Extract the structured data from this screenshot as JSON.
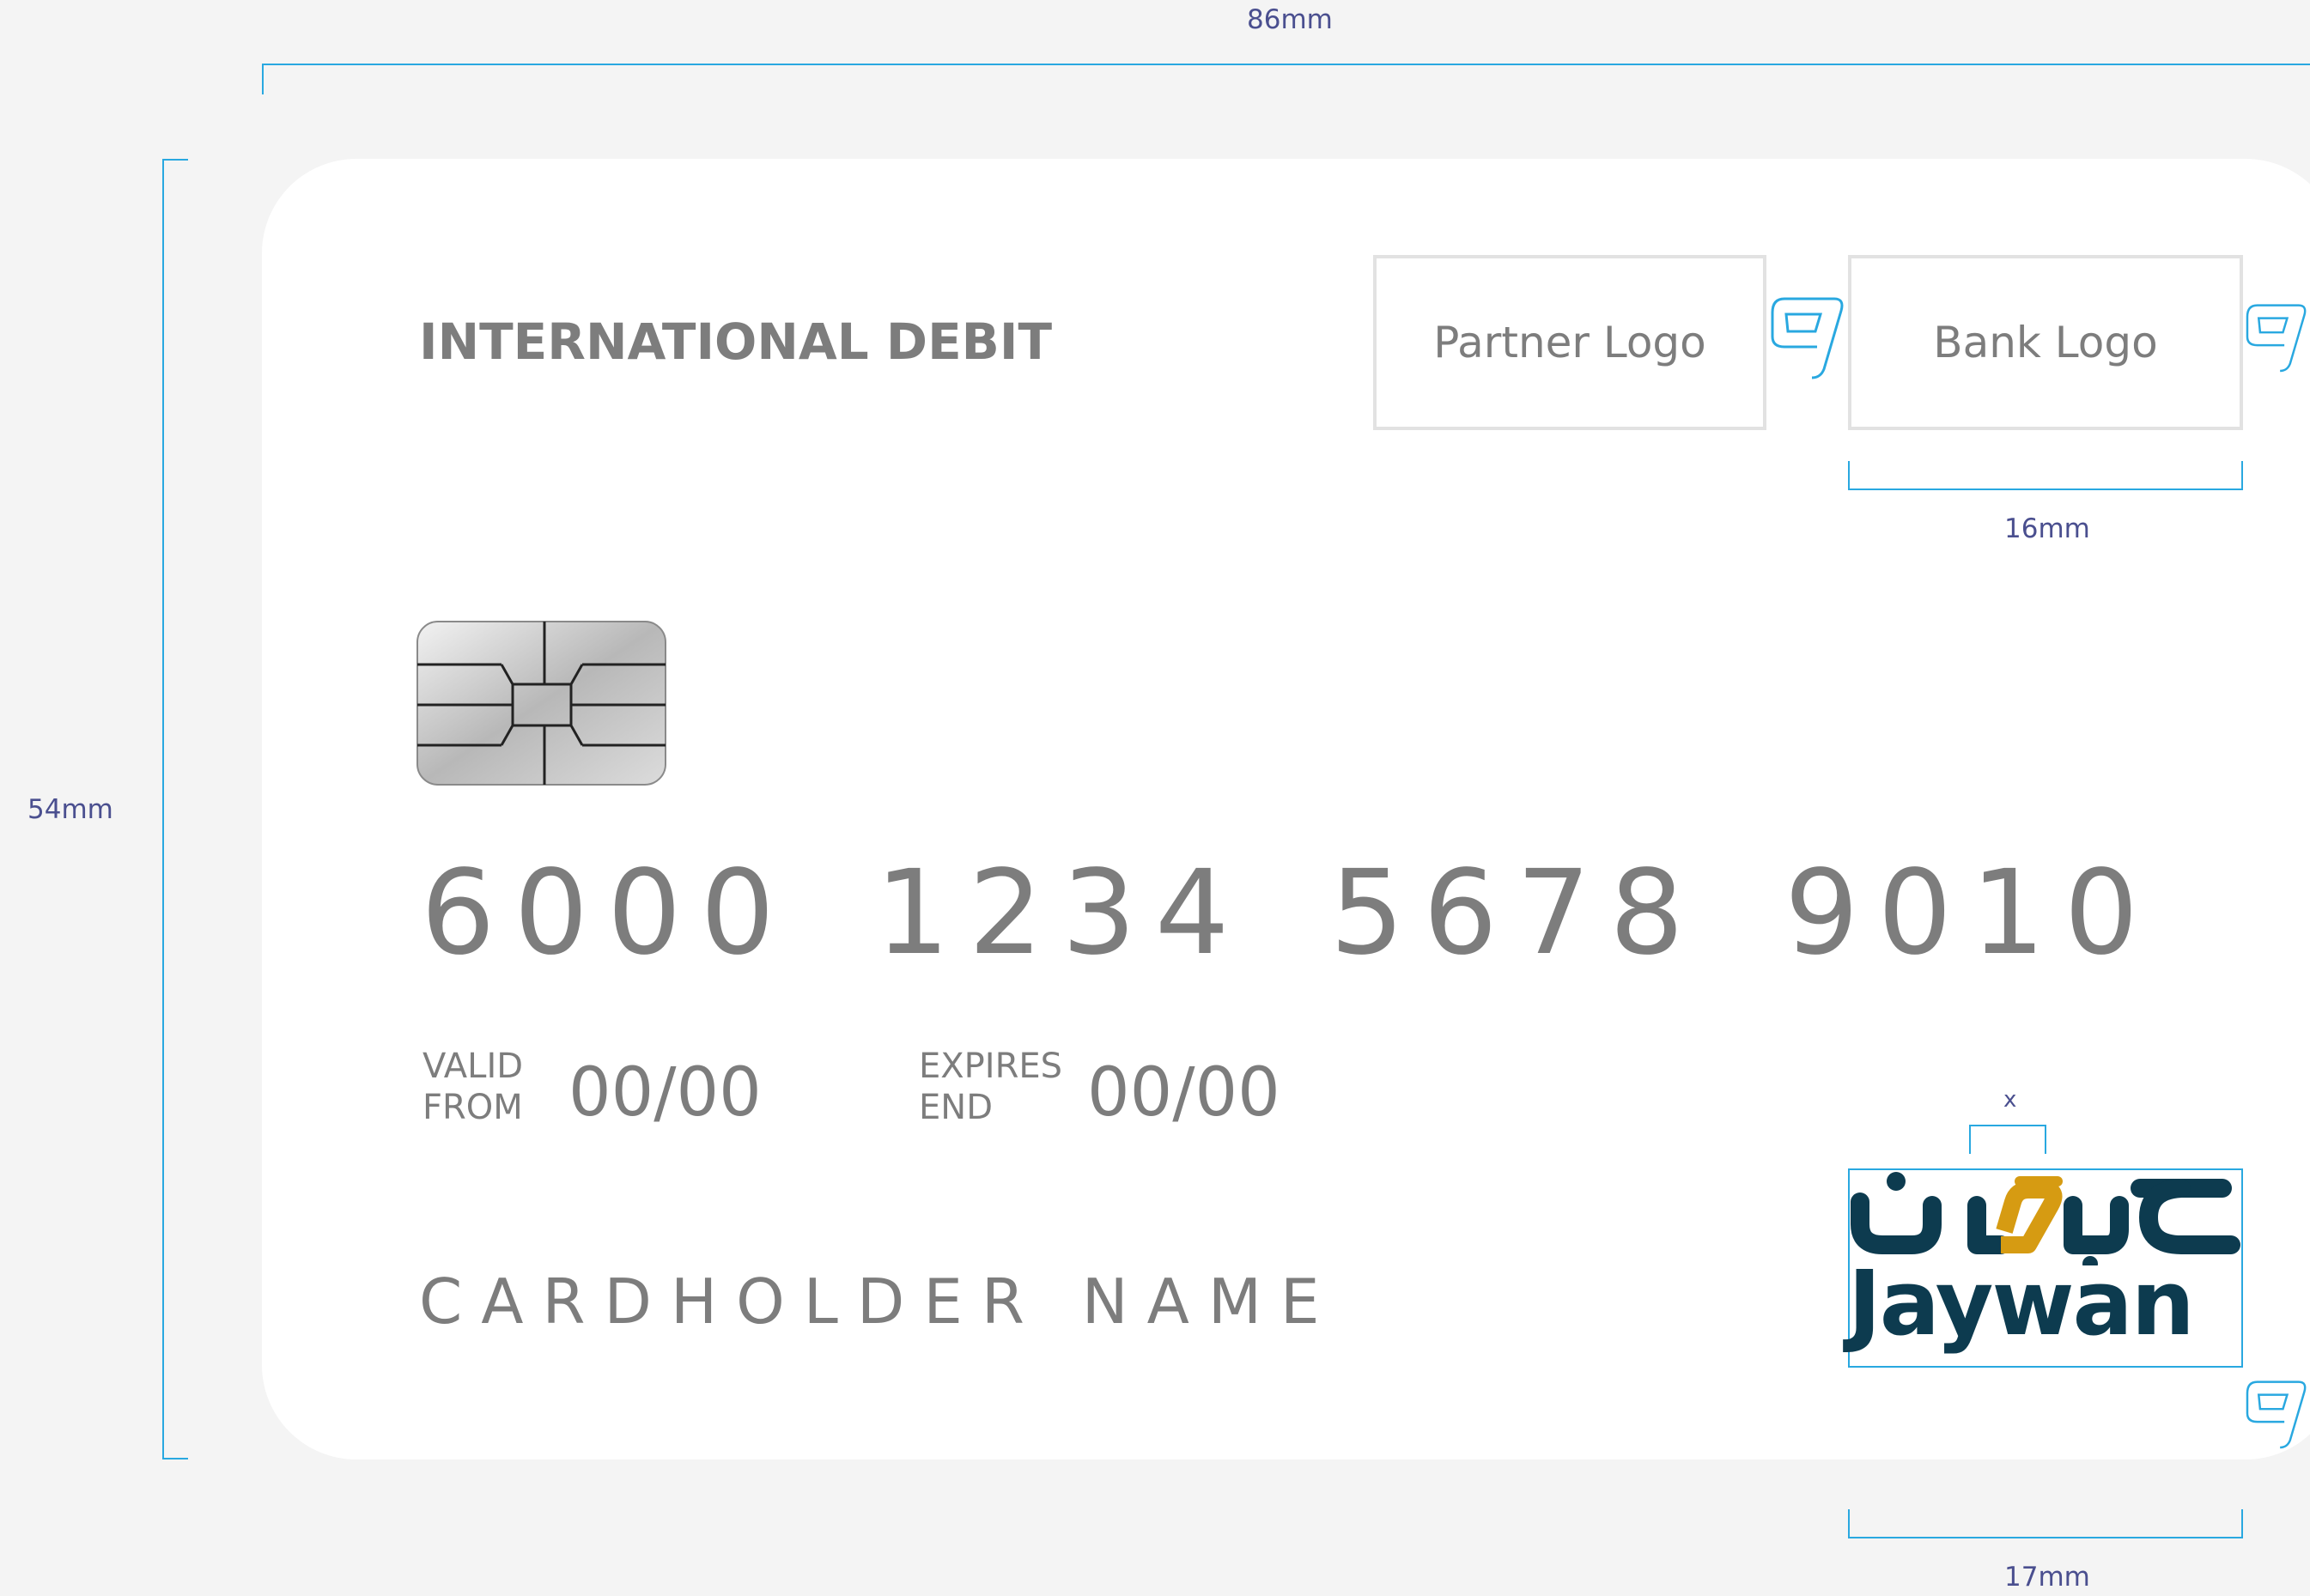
{
  "dimensions": {
    "width_label": "86mm",
    "height_label": "54mm",
    "bank_logo_width_label": "16mm",
    "scheme_logo_width_label": "17mm",
    "clearspace_label": "x"
  },
  "card": {
    "type_label": "INTERNATIONAL DEBIT",
    "partner_logo_label": "Partner Logo",
    "bank_logo_label": "Bank Logo",
    "number": "6000 1234 5678 9010",
    "valid_from": {
      "label_line1": "VALID",
      "label_line2": "FROM",
      "value": "00/00"
    },
    "expires_end": {
      "label_line1": "EXPIRES",
      "label_line2": "END",
      "value": "00/00"
    },
    "cardholder_name": "CARDHOLDER NAME"
  },
  "scheme_logo": {
    "arabic_text": "جيون",
    "latin_text": "Jaywan",
    "colors": {
      "navy": "#0d3b4f",
      "gold": "#d69b12"
    }
  },
  "colors": {
    "guide_blue": "#29a8e0",
    "dimension_text": "#4a4f8f",
    "card_text": "#7d7d7d",
    "background": "#f4f4f4"
  }
}
